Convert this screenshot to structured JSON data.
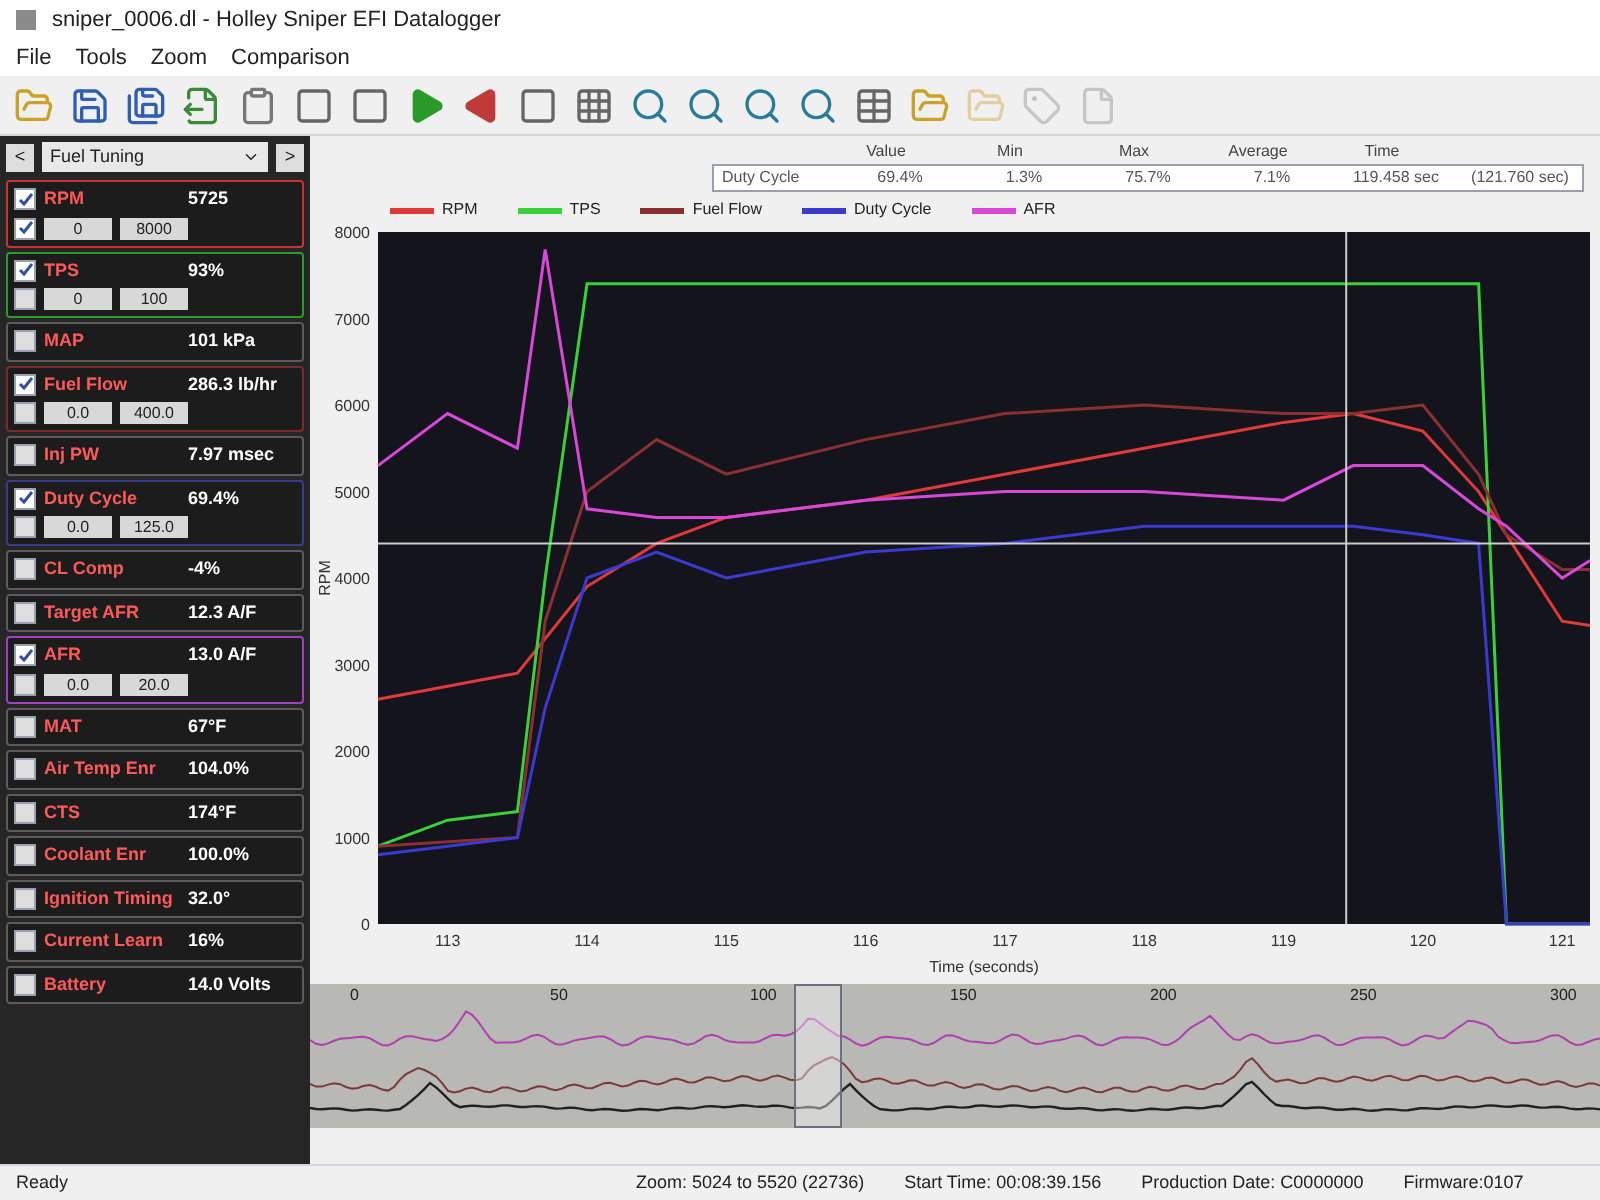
{
  "window": {
    "title": "sniper_0006.dl - Holley Sniper EFI Datalogger"
  },
  "menu": [
    "File",
    "Tools",
    "Zoom",
    "Comparison"
  ],
  "toolbar": [
    {
      "kind": "folder",
      "disabled": false
    },
    {
      "kind": "save",
      "disabled": false
    },
    {
      "kind": "save-all",
      "disabled": false
    },
    {
      "kind": "export",
      "disabled": false
    },
    {
      "kind": "clipboard",
      "disabled": false
    },
    {
      "kind": "square",
      "disabled": false
    },
    {
      "kind": "square",
      "disabled": false
    },
    {
      "kind": "play",
      "disabled": false
    },
    {
      "kind": "reverse",
      "disabled": false
    },
    {
      "kind": "square",
      "disabled": false
    },
    {
      "kind": "grid",
      "disabled": false
    },
    {
      "kind": "zoom",
      "disabled": false
    },
    {
      "kind": "zoom",
      "disabled": false
    },
    {
      "kind": "zoom",
      "disabled": false
    },
    {
      "kind": "zoom",
      "disabled": false
    },
    {
      "kind": "table",
      "disabled": false
    },
    {
      "kind": "folder",
      "disabled": false
    },
    {
      "kind": "folder",
      "disabled": true
    },
    {
      "kind": "tag",
      "disabled": true
    },
    {
      "kind": "file",
      "disabled": true
    }
  ],
  "channel_group": {
    "prev": "<",
    "value": "Fuel Tuning",
    "next": ">"
  },
  "channels": [
    {
      "name": "RPM",
      "value": "5725",
      "checked": true,
      "color": "#c83232",
      "range": {
        "checked": true,
        "min": "0",
        "max": "8000"
      }
    },
    {
      "name": "TPS",
      "value": "93%",
      "checked": true,
      "color": "#2e9a2e",
      "range": {
        "checked": false,
        "min": "0",
        "max": "100"
      }
    },
    {
      "name": "MAP",
      "value": "101 kPa",
      "checked": false,
      "color": "#5a5a5a"
    },
    {
      "name": "Fuel Flow",
      "value": "286.3 lb/hr",
      "checked": true,
      "color": "#7a2a2a",
      "range": {
        "checked": false,
        "min": "0.0",
        "max": "400.0"
      }
    },
    {
      "name": "Inj PW",
      "value": "7.97 msec",
      "checked": false,
      "color": "#5a5a5a"
    },
    {
      "name": "Duty Cycle",
      "value": "69.4%",
      "checked": true,
      "color": "#3a3a8a",
      "range": {
        "checked": false,
        "min": "0.0",
        "max": "125.0"
      }
    },
    {
      "name": "CL Comp",
      "value": "-4%",
      "checked": false,
      "color": "#5a5a5a"
    },
    {
      "name": "Target AFR",
      "value": "12.3 A/F",
      "checked": false,
      "color": "#5a5a5a"
    },
    {
      "name": "AFR",
      "value": "13.0 A/F",
      "checked": true,
      "color": "#a040c0",
      "range": {
        "checked": false,
        "min": "0.0",
        "max": "20.0"
      }
    },
    {
      "name": "MAT",
      "value": "67°F",
      "checked": false,
      "color": "#5a5a5a"
    },
    {
      "name": "Air Temp Enr",
      "value": "104.0%",
      "checked": false,
      "color": "#5a5a5a"
    },
    {
      "name": "CTS",
      "value": "174°F",
      "checked": false,
      "color": "#5a5a5a"
    },
    {
      "name": "Coolant Enr",
      "value": "100.0%",
      "checked": false,
      "color": "#5a5a5a"
    },
    {
      "name": "Ignition Timing",
      "value": "32.0°",
      "checked": false,
      "color": "#5a5a5a"
    },
    {
      "name": "Current Learn",
      "value": "16%",
      "checked": false,
      "color": "#5a5a5a"
    },
    {
      "name": "Battery",
      "value": "14.0 Volts",
      "checked": false,
      "color": "#5a5a5a"
    }
  ],
  "stats": {
    "columns": [
      "Value",
      "Min",
      "Max",
      "Average",
      "Time"
    ],
    "row": {
      "label": "Duty Cycle",
      "cells": [
        "69.4%",
        "1.3%",
        "75.7%",
        "7.1%",
        "119.458 sec",
        "(121.760 sec)"
      ]
    }
  },
  "chart": {
    "chart_data": {
      "type": "line",
      "xlabel": "Time (seconds)",
      "ylabel": "RPM",
      "x": [
        112.5,
        113,
        113.5,
        113.7,
        114,
        114.5,
        115,
        116,
        117,
        118,
        119,
        119.5,
        120,
        120.4,
        120.6,
        121,
        121.2
      ],
      "series": [
        {
          "name": "RPM",
          "color": "#e03a3a",
          "values": [
            2600,
            2750,
            2900,
            3300,
            3900,
            4400,
            4700,
            4900,
            5200,
            5500,
            5800,
            5900,
            5700,
            5000,
            4500,
            3500,
            3450
          ]
        },
        {
          "name": "TPS",
          "color": "#3ad03a",
          "values": [
            900,
            1200,
            1300,
            4000,
            7400,
            7400,
            7400,
            7400,
            7400,
            7400,
            7400,
            7400,
            7400,
            7400,
            0,
            0,
            0
          ]
        },
        {
          "name": "Fuel Flow",
          "color": "#8a3030",
          "values": [
            900,
            950,
            1000,
            3500,
            5000,
            5600,
            5200,
            5600,
            5900,
            6000,
            5900,
            5900,
            6000,
            5200,
            4500,
            4100,
            4100
          ]
        },
        {
          "name": "Duty Cycle",
          "color": "#3a3ad0",
          "values": [
            800,
            900,
            1000,
            2500,
            4000,
            4300,
            4000,
            4300,
            4400,
            4600,
            4600,
            4600,
            4500,
            4400,
            0,
            0,
            0
          ]
        },
        {
          "name": "AFR",
          "color": "#d848d8",
          "values": [
            5300,
            5900,
            5500,
            7800,
            4800,
            4700,
            4700,
            4900,
            5000,
            5000,
            4900,
            5300,
            5300,
            4800,
            4600,
            4000,
            4200
          ]
        }
      ],
      "ref_lines": [
        {
          "axis": "x",
          "value": 119.45
        },
        {
          "axis": "y",
          "value": 4400
        }
      ],
      "legend": "top",
      "xlim": [
        112.5,
        121.2
      ],
      "ylim": [
        0,
        8000
      ],
      "xticks": [
        113,
        114,
        115,
        116,
        117,
        118,
        119,
        120,
        121
      ],
      "yticks": [
        0,
        1000,
        2000,
        3000,
        4000,
        5000,
        6000,
        7000,
        8000
      ]
    }
  },
  "overview": {
    "ticks": [
      "0",
      "50",
      "100",
      "150",
      "200",
      "250",
      "300"
    ]
  },
  "status_bar": {
    "left": "Ready",
    "items": [
      "Zoom: 5024 to 5520 (22736)",
      "Start Time: 00:08:39.156",
      "Production Date: C0000000",
      "Firmware:0107"
    ]
  }
}
